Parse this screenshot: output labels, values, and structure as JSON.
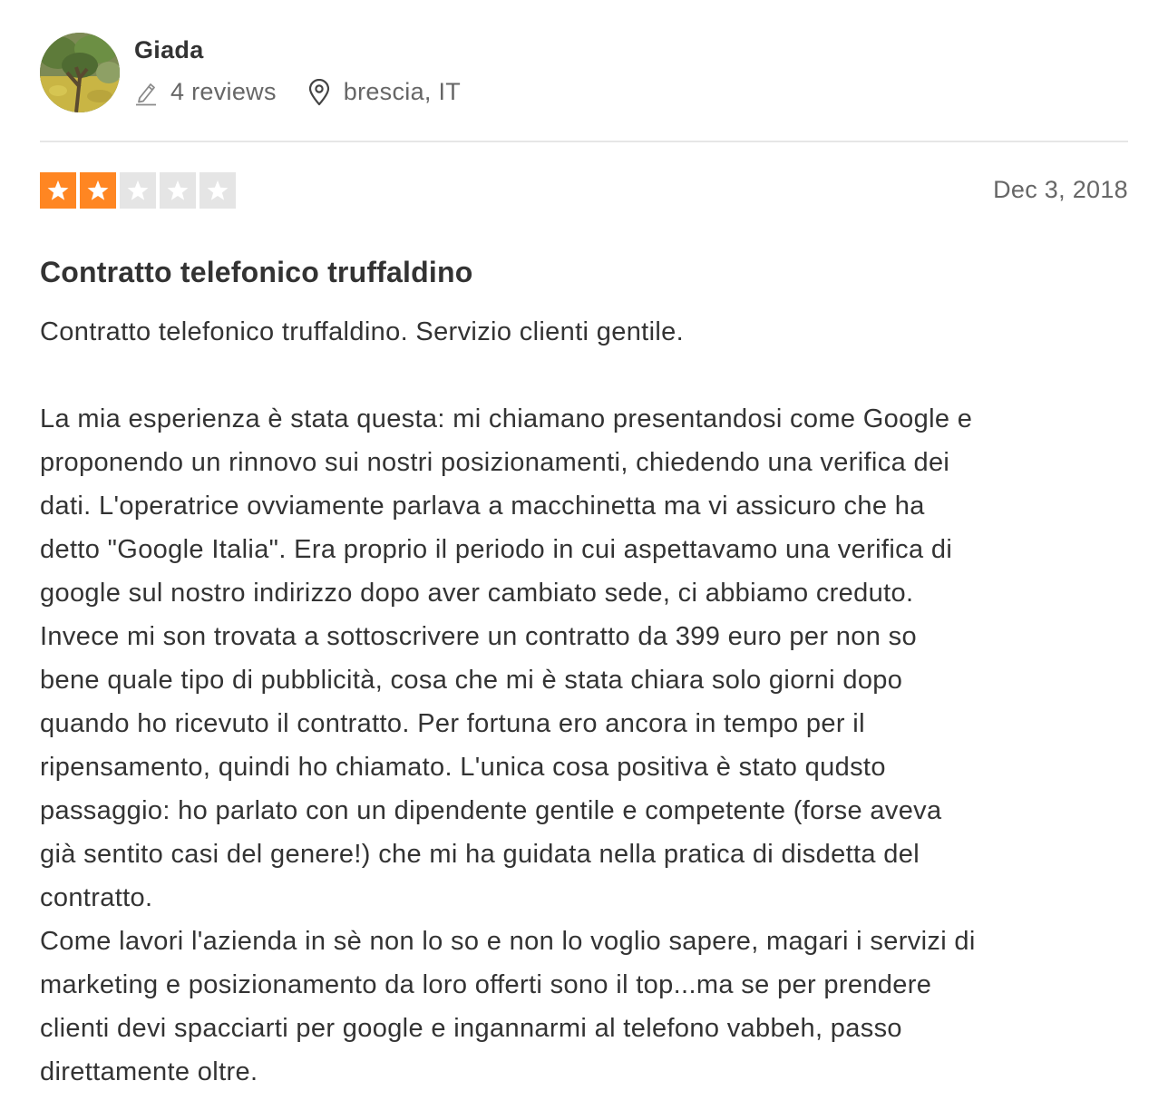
{
  "reviewer": {
    "name": "Giada",
    "reviews_count": "4 reviews",
    "location": "brescia, IT",
    "avatar_icon": "avatar-photo-tree"
  },
  "review": {
    "rating": 2,
    "max_rating": 5,
    "star_color_filled": "#ff8622",
    "star_color_empty": "#e5e5e5",
    "date": "Dec 3, 2018",
    "title": "Contratto telefonico truffaldino",
    "paragraphs": [
      "Contratto telefonico truffaldino. Servizio clienti gentile.",
      "La mia esperienza è stata questa: mi chiamano presentandosi come Google e\nproponendo un rinnovo sui nostri posizionamenti, chiedendo una verifica dei\ndati. L'operatrice ovviamente parlava a macchinetta ma vi assicuro che ha\ndetto \"Google Italia\". Era proprio il periodo in cui aspettavamo una verifica di\ngoogle sul nostro indirizzo dopo aver cambiato sede, ci abbiamo creduto.\nInvece mi son trovata a sottoscrivere un contratto da 399 euro per non so\nbene quale tipo di pubblicità, cosa che mi è stata chiara solo giorni dopo\nquando ho ricevuto il contratto. Per fortuna ero ancora in tempo per il\nripensamento, quindi ho chiamato. L'unica cosa positiva è stato qudsto\npassaggio: ho parlato con un dipendente gentile e competente (forse aveva\ngià sentito casi del genere!) che mi ha guidata nella pratica di disdetta del\ncontratto.\nCome lavori l'azienda in sè non lo so e non lo voglio sapere, magari i servizi di\nmarketing e posizionamento da loro offerti sono il top...ma se per prendere\nclienti devi spacciarti per google e ingannarmi al telefono vabbeh, passo\ndirettamente oltre."
    ]
  },
  "icons": {
    "reviews": "pencil-icon",
    "location": "location-pin-icon",
    "star": "star-icon"
  }
}
